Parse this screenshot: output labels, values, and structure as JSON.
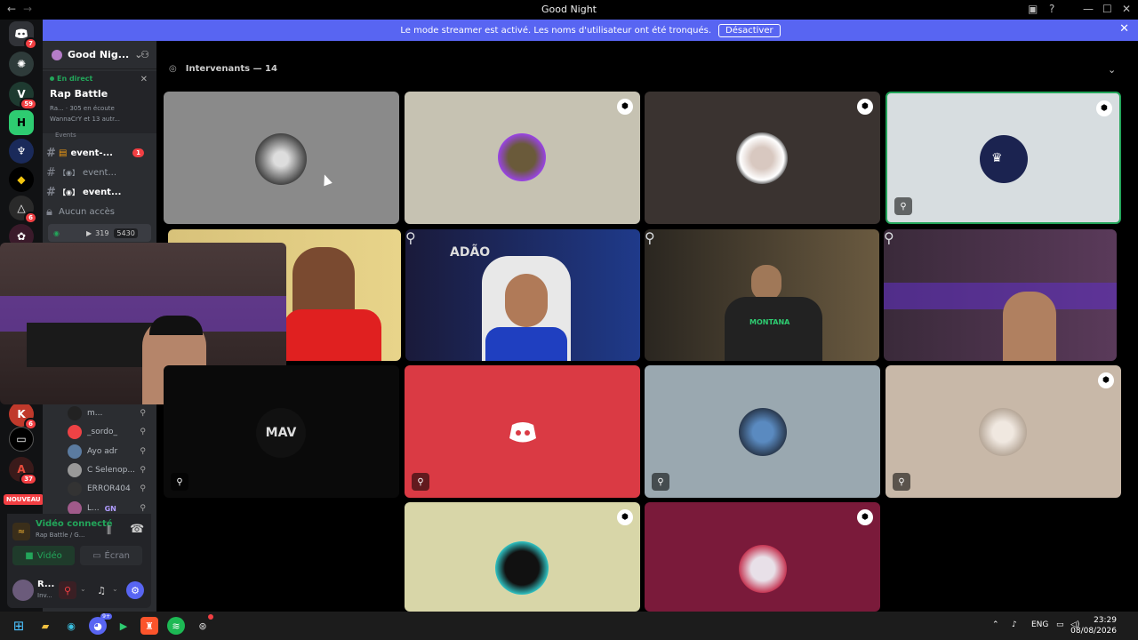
{
  "window": {
    "title": "Good Night",
    "back_icon": "←",
    "forward_icon": "→",
    "minimize": "—",
    "maximize": "☐",
    "close": "✕"
  },
  "banner": {
    "message": "Le mode streamer est activé. Les noms d'utilisateur ont été tronqués.",
    "button": "Désactiver",
    "close": "✕"
  },
  "servers": {
    "discord_badge": "7",
    "badge_59": "59",
    "badge_6": "6",
    "badge_6b": "6",
    "badge_37": "37",
    "nouveau": "NOUVEAU"
  },
  "sidebar": {
    "server_name": "Good Nig...",
    "live_label": "En direct",
    "stage_name": "Rap Battle",
    "stage_info": "Ra... · 305 en écoute",
    "stage_users": "WannaCrY et 13 autr...",
    "events_label": "Events",
    "channels": [
      {
        "label": "event-...",
        "badge": "1"
      },
      {
        "label": "event..."
      },
      {
        "label": "event..."
      },
      {
        "label": "Aucun accès"
      }
    ],
    "voice_row": {
      "count1": "319",
      "count2": "5430"
    },
    "voice_users": [
      {
        "label": "m..."
      },
      {
        "label": "_sordo_"
      },
      {
        "label": "Ayo adr"
      },
      {
        "label": "C Selenop..."
      },
      {
        "label": "ERROR404"
      },
      {
        "label": "L...",
        "tag": "GN"
      }
    ]
  },
  "voice_panel": {
    "status": "Vidéo connecté",
    "channel": "Rap Battle / G...",
    "video_button": "Vidéo",
    "screen_button": "Écran"
  },
  "user_panel": {
    "name": "R...",
    "status": "Inv..."
  },
  "stage": {
    "header": "Intervenants — 14"
  },
  "tile_labels": {
    "discord_logo": "Discord",
    "mav": "MAV"
  },
  "cam_text": {
    "adao": "ADÃO",
    "montana": "MONTANA"
  },
  "taskbar": {
    "lang": "ENG",
    "time": "23:29",
    "date": "08/08/2026",
    "discord_badge": "9+"
  },
  "colors": {
    "accent": "#5865f2",
    "online": "#23a55a",
    "danger": "#f23f43",
    "active_border": "#23a55a"
  }
}
